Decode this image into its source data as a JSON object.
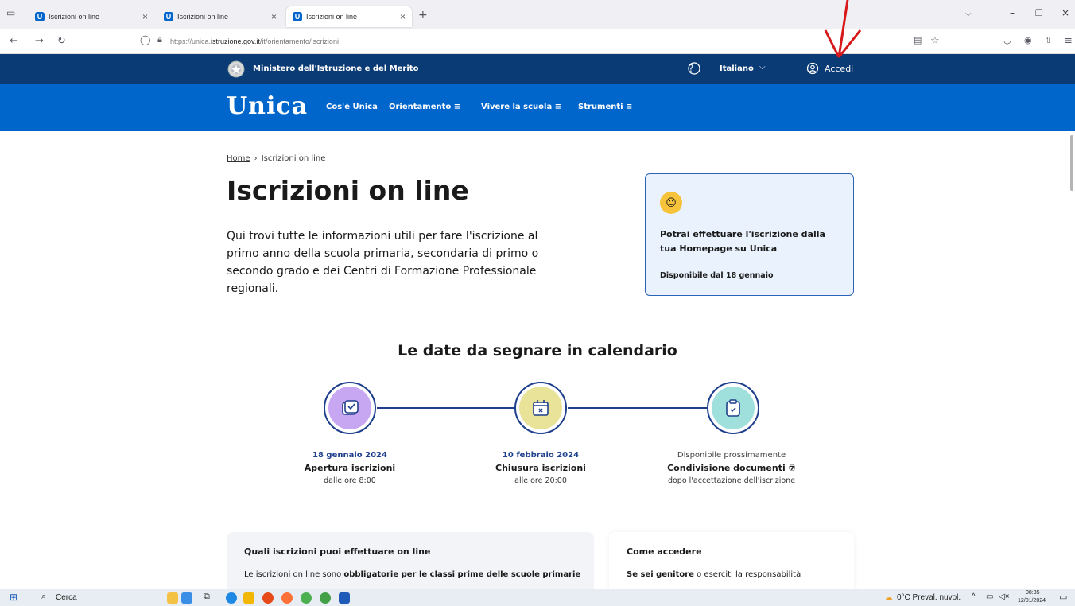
{
  "browser": {
    "tabs": [
      {
        "label": "Iscrizioni on line",
        "active": false
      },
      {
        "label": "Iscrizioni on line",
        "active": false
      },
      {
        "label": "Iscrizioni on line",
        "active": true
      }
    ],
    "new_tab": "+",
    "url_prefix": "https://unica.",
    "url_host": "istruzione.gov.it",
    "url_path": "/it/orientamento/iscrizioni"
  },
  "ministry_bar": {
    "name": "Ministero dell'Istruzione e del Merito",
    "language": "Italiano",
    "login": "Accedi"
  },
  "main_nav": {
    "logo": "Unica",
    "items": [
      "Cos'è Unica",
      "Orientamento ≡",
      "Vivere la scuola ≡",
      "Strumenti ≡"
    ]
  },
  "breadcrumb": {
    "home": "Home",
    "sep": "›",
    "current": "Iscrizioni on line"
  },
  "page": {
    "title": "Iscrizioni on line",
    "intro": "Qui trovi tutte le informazioni utili per fare l'iscrizione al primo anno della scuola primaria, secondaria di primo o secondo grado e dei Centri di Formazione Professionale regionali."
  },
  "card": {
    "title": "Potrai effettuare l'iscrizione dalla tua Homepage su Unica",
    "subtitle": "Disponibile dal 18 gennaio"
  },
  "calendar": {
    "heading": "Le date da segnare in calendario",
    "steps": [
      {
        "date": "18 gennaio 2024",
        "title": "Apertura iscrizioni",
        "sub": "dalle ore 8:00",
        "color": "#c7a6f2"
      },
      {
        "date": "10 febbraio 2024",
        "title": "Chiusura iscrizioni",
        "sub": "alle ore 20:00",
        "color": "#e9e39a"
      },
      {
        "date": "Disponibile prossimamente",
        "title": "Condivisione documenti ⑦",
        "sub": "dopo l'accettazione dell'iscrizione",
        "color": "#9fe0dc"
      }
    ]
  },
  "panels": {
    "left_title": "Quali iscrizioni puoi effettuare on line",
    "left_text_a": "Le iscrizioni on line sono ",
    "left_text_b": "obbligatorie per le classi prime delle scuole primarie",
    "right_title": "Come accedere",
    "right_text_a": "Se sei genitore",
    "right_text_b": " o eserciti la responsabilità"
  },
  "taskbar": {
    "search": "Cerca",
    "weather": "0°C  Preval. nuvol.",
    "time": "08:35",
    "date": "12/01/2024"
  },
  "colors": {
    "ministry": "#0b3b74",
    "nav": "#0066cc",
    "accent": "#1e3f8c",
    "annotation": "#d7191c"
  }
}
